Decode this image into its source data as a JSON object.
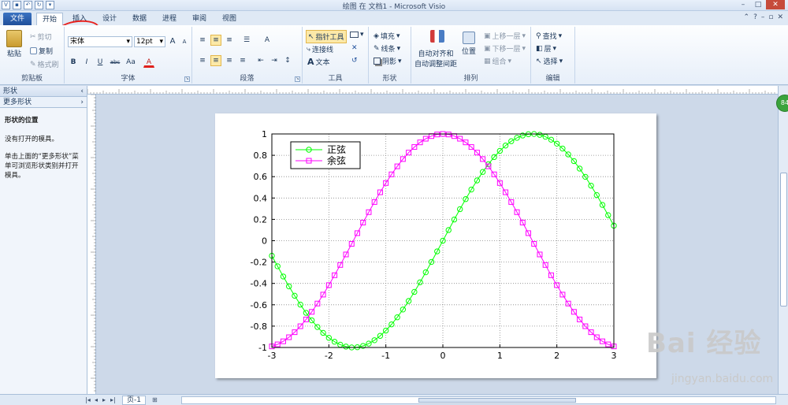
{
  "window": {
    "title": "绘图 在 文档1 - Microsoft Visio"
  },
  "tabs": {
    "file": "文件",
    "home": "开始",
    "insert": "插入",
    "design": "设计",
    "data": "数据",
    "process": "进程",
    "review": "审阅",
    "view": "视图"
  },
  "clipboard": {
    "paste": "粘贴",
    "cut": "剪切",
    "copy": "复制",
    "format_painter": "格式刷",
    "label": "剪贴板"
  },
  "font": {
    "name": "宋体",
    "size": "12pt",
    "grow": "A",
    "shrink": "A",
    "bold": "B",
    "italic": "I",
    "underline": "U",
    "strike": "abc",
    "case": "Aa",
    "color_letter": "A",
    "label": "字体"
  },
  "paragraph": {
    "label": "段落"
  },
  "tools": {
    "pointer": "指针工具",
    "connector": "连接线",
    "text": "文本",
    "label": "工具"
  },
  "shape": {
    "fill": "填充",
    "line": "线条",
    "shadow": "阴影",
    "label": "形状"
  },
  "arrange": {
    "auto_align": "自动对齐和",
    "auto_space": "自动调整间距",
    "position": "位置",
    "bring_forward": "上移一层",
    "send_backward": "下移一层",
    "group": "组合",
    "label": "排列"
  },
  "editing": {
    "find": "查找",
    "layer": "层",
    "select": "选择",
    "label": "编辑"
  },
  "shapes_panel": {
    "header": "形状",
    "more_shapes": "更多形状",
    "title": "形状的位置",
    "line1": "没有打开的模具。",
    "line2": "单击上面的“更多形状”菜单可浏览形状类别并打开模具。"
  },
  "status": {
    "page_tab": "页-1"
  },
  "badge": "84",
  "watermark": {
    "brand": "Bai 经验",
    "url": "jingyan.baidu.com"
  },
  "chart_data": {
    "type": "line",
    "title": "",
    "xlabel": "",
    "ylabel": "",
    "xlim": [
      -3,
      3
    ],
    "ylim": [
      -1,
      1
    ],
    "xticks": [
      "-3",
      "-2",
      "-1",
      "0",
      "1",
      "2",
      "3"
    ],
    "yticks": [
      "-1",
      "-0.8",
      "-0.6",
      "-0.4",
      "-0.2",
      "0",
      "0.2",
      "0.4",
      "0.6",
      "0.8",
      "1"
    ],
    "grid": true,
    "legend": "top-left",
    "series": [
      {
        "name": "正弦",
        "function": "sin",
        "color": "#00ff00",
        "marker": "circle"
      },
      {
        "name": "余弦",
        "function": "cos",
        "color": "#ff00ff",
        "marker": "square"
      }
    ],
    "x_step": 0.1
  }
}
